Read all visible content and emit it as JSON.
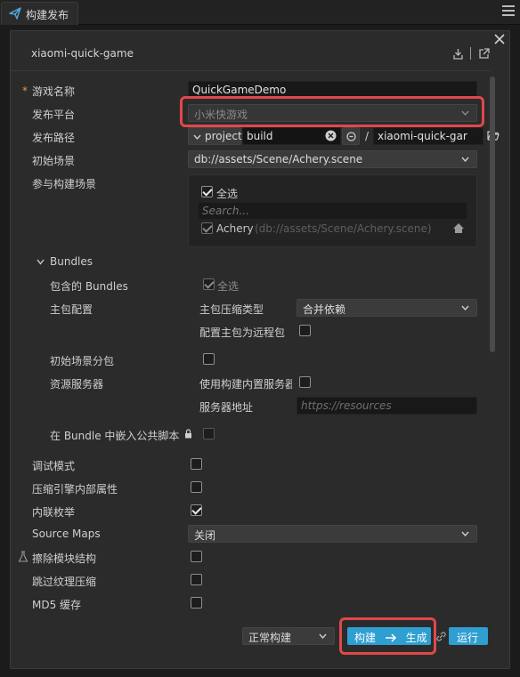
{
  "tab": {
    "label": "构建发布"
  },
  "header": {
    "title": "xiaomi-quick-game"
  },
  "fields": {
    "game_name_label": "游戏名称",
    "game_name_value": "QuickGameDemo",
    "platform_label": "发布平台",
    "platform_value": "小米快游戏",
    "path_label": "发布路径",
    "path_root": "project",
    "path_folder": "build",
    "path_sep": "/",
    "path_name": "xiaomi-quick-gar",
    "start_scene_label": "初始场景",
    "start_scene_value": "db://assets/Scene/Achery.scene",
    "scenes_label": "参与构建场景",
    "select_all": "全选",
    "search_placeholder": "Search...",
    "scene_item_name": "Achery",
    "scene_item_path": "(db://assets/Scene/Achery.scene)"
  },
  "bundles": {
    "section_label": "Bundles",
    "included_label": "包含的 Bundles",
    "included_select_all": "全选",
    "main_config_label": "主包配置",
    "compress_type_label": "主包压缩类型",
    "compress_type_value": "合并依赖",
    "main_remote_label": "配置主包为远程包",
    "start_scene_subpkg_label": "初始场景分包",
    "resource_server_label": "资源服务器",
    "use_builtin_server_label": "使用构建内置服务器",
    "server_address_label": "服务器地址",
    "server_address_placeholder": "https://resources",
    "embed_script_label": "在 Bundle 中嵌入公共脚本"
  },
  "options": {
    "debug_label": "调试模式",
    "compress_props_label": "压缩引擎内部属性",
    "inline_enum_label": "内联枚举",
    "source_maps_label": "Source Maps",
    "source_maps_value": "关闭",
    "erase_modules_label": "擦除模块结构",
    "skip_texture_label": "跳过纹理压缩",
    "md5_label": "MD5 缓存"
  },
  "states": {
    "select_all": true,
    "scene_item": true,
    "bundles_all": true,
    "main_remote": false,
    "start_scene_subpkg": false,
    "use_builtin_server": false,
    "embed_script": false,
    "debug": false,
    "compress_props": false,
    "inline_enum": true,
    "erase_modules": false,
    "skip_texture": false,
    "md5": false
  },
  "footer": {
    "build_mode": "正常构建",
    "build_label": "构建",
    "generate_label": "生成",
    "run_label": "运行"
  },
  "colors": {
    "accent": "#2f9ed1",
    "highlight": "#e0484a",
    "panel": "#2b2b2b"
  }
}
